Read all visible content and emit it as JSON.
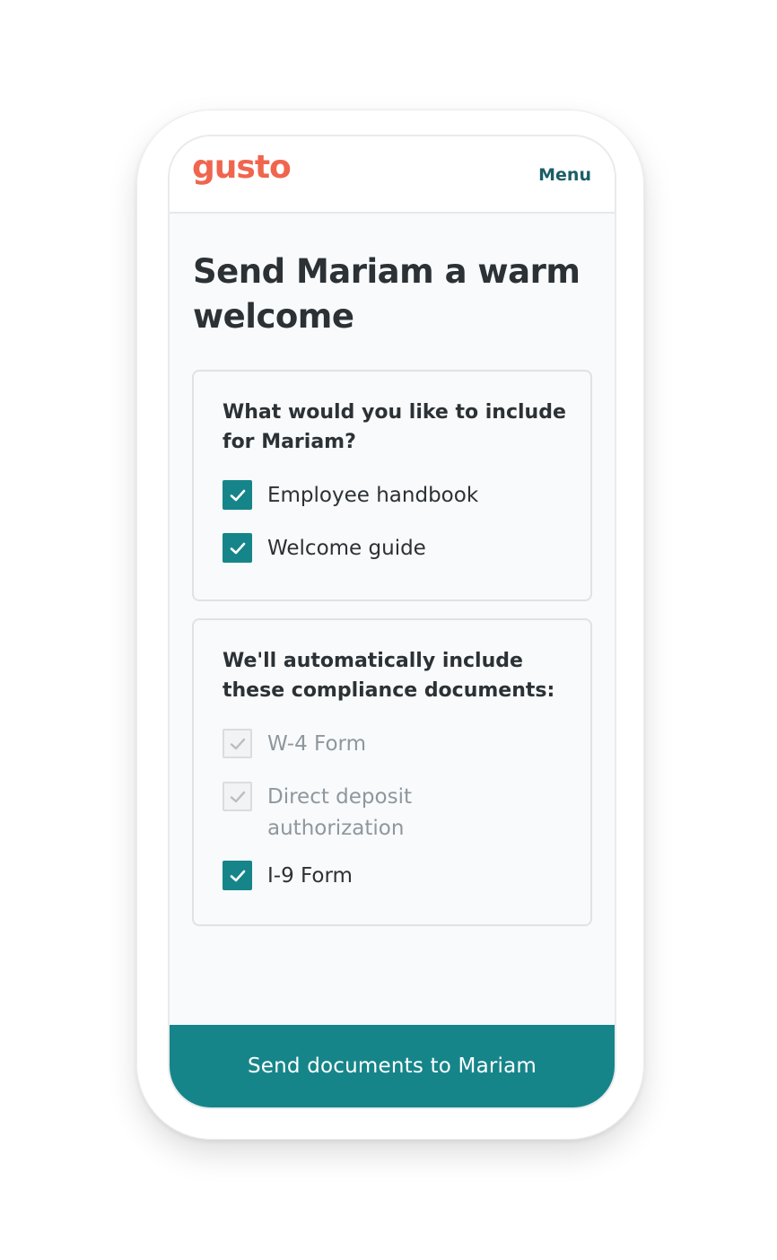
{
  "brand": {
    "logo_text": "gusto",
    "logo_color": "#f0654e"
  },
  "header": {
    "menu_label": "Menu"
  },
  "page": {
    "title": "Send Mariam a warm welcome"
  },
  "optional_section": {
    "heading": "What would you like to include for Mariam?",
    "items": [
      {
        "label": "Employee handbook",
        "checked": true,
        "disabled": false
      },
      {
        "label": "Welcome guide",
        "checked": true,
        "disabled": false
      }
    ]
  },
  "compliance_section": {
    "heading": "We'll automatically include these compliance documents:",
    "items": [
      {
        "label": "W-4 Form",
        "checked": true,
        "disabled": true
      },
      {
        "label": "Direct deposit authorization",
        "checked": true,
        "disabled": true
      },
      {
        "label": "I-9 Form",
        "checked": true,
        "disabled": false
      }
    ]
  },
  "cta": {
    "label": "Send documents to Mariam"
  },
  "colors": {
    "accent": "#16858a",
    "text": "#2c3135",
    "muted": "#8f979d"
  }
}
